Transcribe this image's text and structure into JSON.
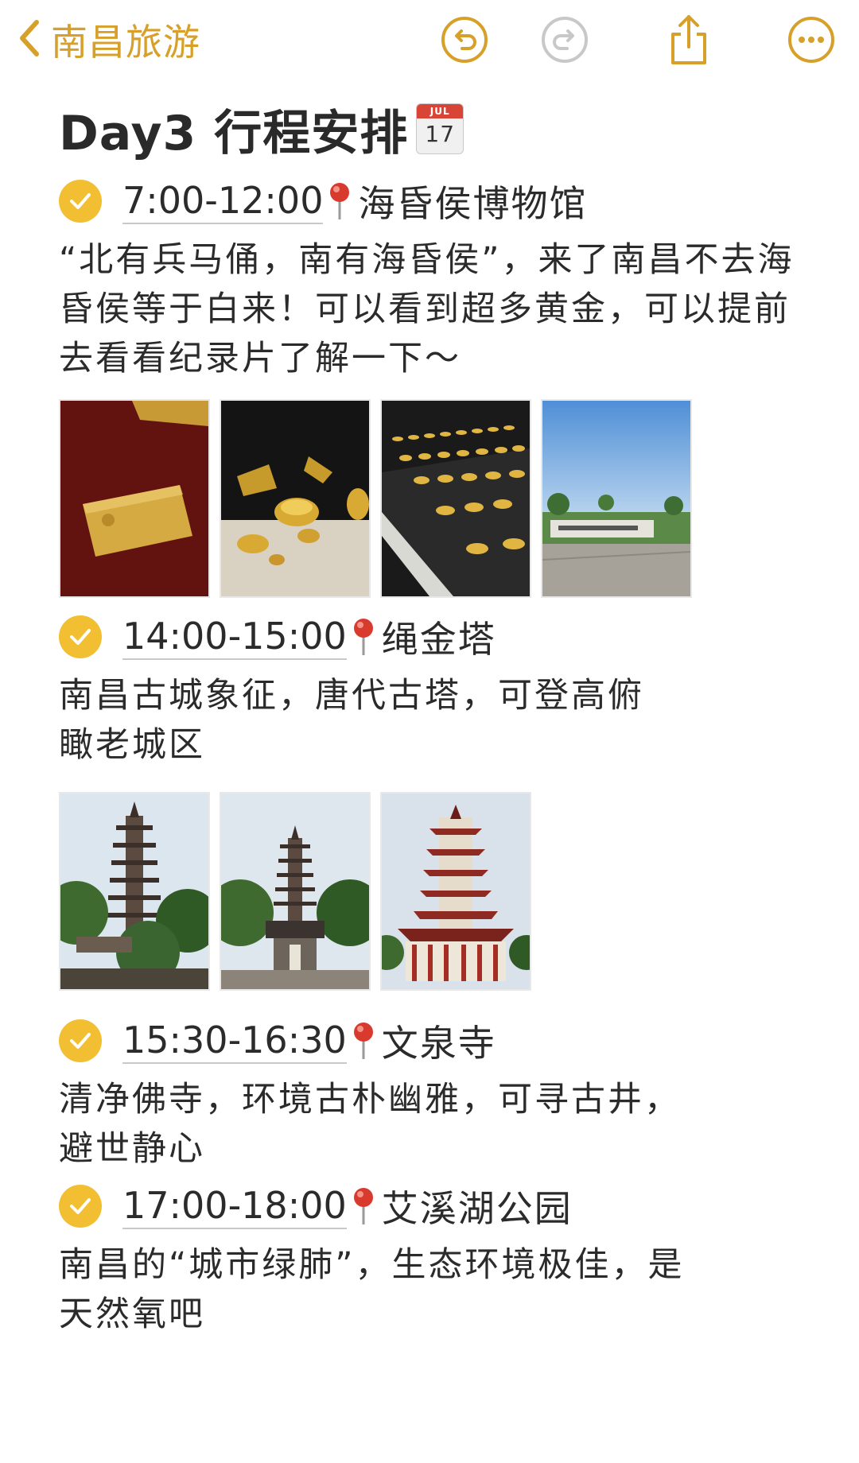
{
  "nav": {
    "back_label": "南昌旅游"
  },
  "note": {
    "title": "Day3 行程安排",
    "calendar_month": "JUL",
    "calendar_day": "17"
  },
  "items": [
    {
      "time": "7:00-12:00",
      "place": "海昏侯博物馆",
      "desc": "“北有兵马俑，南有海昏侯”，来了南昌不去海昏侯等于白来！可以看到超多黄金，可以提前去看看纪录片了解一下～",
      "photo_count": 4
    },
    {
      "time": "14:00-15:00",
      "place": "绳金塔",
      "desc": "南昌古城象征，唐代古塔，可登高俯瞰老城区",
      "photo_count": 3
    },
    {
      "time": "15:30-16:30",
      "place": "文泉寺",
      "desc": "清净佛寺，环境古朴幽雅，可寻古井，避世静心"
    },
    {
      "time": "17:00-18:00",
      "place": "艾溪湖公园",
      "desc": "南昌的“城市绿肺”，生态环境极佳，是天然氧吧"
    }
  ],
  "colors": {
    "accent": "#d6a02a",
    "check": "#f2be32",
    "pin": "#d83a2e"
  }
}
